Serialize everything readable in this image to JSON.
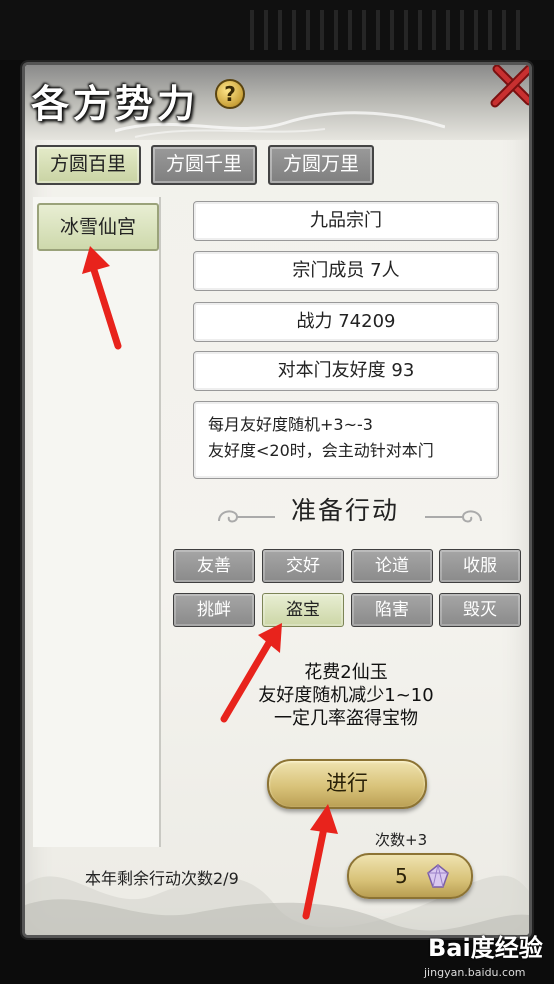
{
  "window": {
    "title": "各方势力",
    "help_label": "?"
  },
  "tabs": [
    {
      "label": "方圆百里",
      "active": true
    },
    {
      "label": "方圆千里",
      "active": false
    },
    {
      "label": "方圆万里",
      "active": false
    }
  ],
  "sect_list": [
    {
      "label": "冰雪仙宫",
      "selected": true
    }
  ],
  "info": {
    "name": "九品宗门",
    "members": "宗门成员 7人",
    "power": "战力 74209",
    "friendship": "对本门友好度 93",
    "desc_line1": "每月友好度随机+3~-3",
    "desc_line2": "友好度<20时，会主动针对本门"
  },
  "actions_title": "准备行动",
  "actions": [
    {
      "label": "友善",
      "selected": false
    },
    {
      "label": "交好",
      "selected": false
    },
    {
      "label": "论道",
      "selected": false
    },
    {
      "label": "收服",
      "selected": false
    },
    {
      "label": "挑衅",
      "selected": false
    },
    {
      "label": "盗宝",
      "selected": true
    },
    {
      "label": "陷害",
      "selected": false
    },
    {
      "label": "毁灭",
      "selected": false
    }
  ],
  "cost": {
    "line1": "花费2仙玉",
    "line2": "友好度随机减少1~10",
    "line3": "一定几率盗得宝物"
  },
  "go_button": "进行",
  "count_plus": "次数+3",
  "remaining": "本年剩余行动次数2/9",
  "buy_count_value": "5",
  "watermark": {
    "logo": "Bai度经验",
    "url": "jingyan.baidu.com"
  },
  "colors": {
    "accent_green": "#ccd6a6",
    "gold": "#d9c37a",
    "inactive_gray": "#8a8a8a",
    "arrow_red": "#e8231c"
  }
}
